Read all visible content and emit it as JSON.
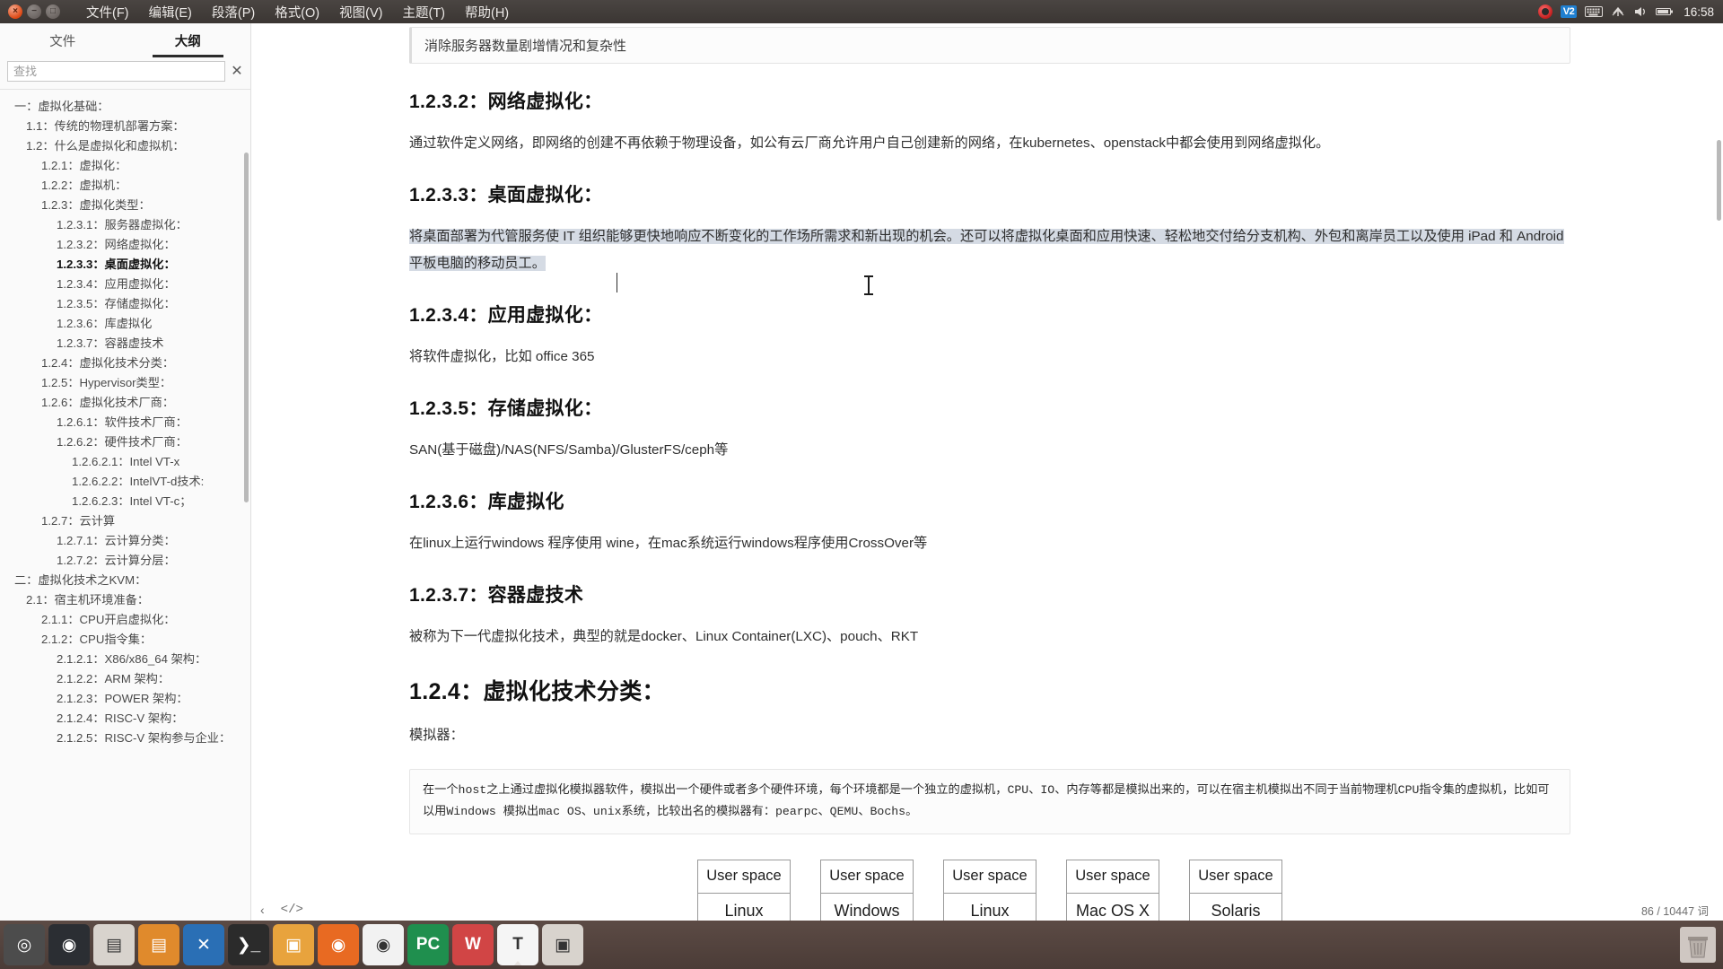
{
  "window": {
    "controls": [
      "close",
      "minimize",
      "maximize"
    ],
    "menu": [
      "文件(F)",
      "编辑(E)",
      "段落(P)",
      "格式(O)",
      "视图(V)",
      "主题(T)",
      "帮助(H)"
    ]
  },
  "tray": {
    "recording_icon": "obs-record-icon",
    "vpn_badge": "V2",
    "keyboard_icon": "keyboard-icon",
    "network_icon": "network-icon",
    "volume_icon": "volume-icon",
    "battery_icon": "battery-icon",
    "time": "16:58"
  },
  "sidebar": {
    "tabs": [
      {
        "label": "文件",
        "active": false
      },
      {
        "label": "大纲",
        "active": true
      }
    ],
    "search": {
      "placeholder": "查找",
      "value": ""
    },
    "clear_label": "✕",
    "outline": [
      {
        "level": 1,
        "label": "一：虚拟化基础：",
        "selected": false
      },
      {
        "level": 2,
        "label": "1.1：传统的物理机部署方案：",
        "selected": false
      },
      {
        "level": 2,
        "label": "1.2：什么是虚拟化和虚拟机：",
        "selected": false
      },
      {
        "level": 3,
        "label": "1.2.1：虚拟化：",
        "selected": false
      },
      {
        "level": 3,
        "label": "1.2.2：虚拟机：",
        "selected": false
      },
      {
        "level": 3,
        "label": "1.2.3：虚拟化类型：",
        "selected": false
      },
      {
        "level": 4,
        "label": "1.2.3.1：服务器虚拟化：",
        "selected": false
      },
      {
        "level": 4,
        "label": "1.2.3.2：网络虚拟化：",
        "selected": false
      },
      {
        "level": 4,
        "label": "1.2.3.3：桌面虚拟化：",
        "selected": true
      },
      {
        "level": 4,
        "label": "1.2.3.4：应用虚拟化：",
        "selected": false
      },
      {
        "level": 4,
        "label": "1.2.3.5：存储虚拟化：",
        "selected": false
      },
      {
        "level": 4,
        "label": "1.2.3.6：库虚拟化",
        "selected": false
      },
      {
        "level": 4,
        "label": "1.2.3.7：容器虚技术",
        "selected": false
      },
      {
        "level": 3,
        "label": "1.2.4：虚拟化技术分类：",
        "selected": false
      },
      {
        "level": 3,
        "label": "1.2.5：Hypervisor类型：",
        "selected": false
      },
      {
        "level": 3,
        "label": "1.2.6：虚拟化技术厂商：",
        "selected": false
      },
      {
        "level": 4,
        "label": "1.2.6.1：软件技术厂商：",
        "selected": false
      },
      {
        "level": 4,
        "label": "1.2.6.2：硬件技术厂商：",
        "selected": false
      },
      {
        "level": 5,
        "label": "1.2.6.2.1：Intel VT-x",
        "selected": false
      },
      {
        "level": 5,
        "label": "1.2.6.2.2：IntelVT-d技术:",
        "selected": false
      },
      {
        "level": 5,
        "label": "1.2.6.2.3：Intel VT-c；",
        "selected": false
      },
      {
        "level": 3,
        "label": "1.2.7：云计算",
        "selected": false
      },
      {
        "level": 4,
        "label": "1.2.7.1：云计算分类：",
        "selected": false
      },
      {
        "level": 4,
        "label": "1.2.7.2：云计算分层：",
        "selected": false
      },
      {
        "level": 1,
        "label": "二：虚拟化技术之KVM：",
        "selected": false
      },
      {
        "level": 2,
        "label": "2.1：宿主机环境准备：",
        "selected": false
      },
      {
        "level": 3,
        "label": "2.1.1：CPU开启虚拟化：",
        "selected": false
      },
      {
        "level": 3,
        "label": "2.1.2：CPU指令集：",
        "selected": false
      },
      {
        "level": 4,
        "label": "2.1.2.1：X86/x86_64 架构：",
        "selected": false
      },
      {
        "level": 4,
        "label": "2.1.2.2：ARM 架构：",
        "selected": false
      },
      {
        "level": 4,
        "label": "2.1.2.3：POWER 架构：",
        "selected": false
      },
      {
        "level": 4,
        "label": "2.1.2.4：RISC-V 架构：",
        "selected": false
      },
      {
        "level": 4,
        "label": "2.1.2.5：RISC-V 架构参与企业：",
        "selected": false
      }
    ]
  },
  "document": {
    "top_quote": "消除服务器数量剧增情况和复杂性",
    "sections": [
      {
        "heading": "1.2.3.2：网络虚拟化：",
        "paragraph": "通过软件定义网络，即网络的创建不再依赖于物理设备，如公有云厂商允许用户自己创建新的网络，在kubernetes、openstack中都会使用到网络虚拟化。"
      },
      {
        "heading": "1.2.3.3：桌面虚拟化：",
        "paragraph": "将桌面部署为代管服务使 IT 组织能够更快地响应不断变化的工作场所需求和新出现的机会。还可以将虚拟化桌面和应用快速、轻松地交付给分支机构、外包和离岸员工以及使用 iPad 和 Android 平板电脑的移动员工。",
        "highlighted": true
      },
      {
        "heading": "1.2.3.4：应用虚拟化：",
        "paragraph": "将软件虚拟化，比如 office 365"
      },
      {
        "heading": "1.2.3.5：存储虚拟化：",
        "paragraph": "SAN(基于磁盘)/NAS(NFS/Samba)/GlusterFS/ceph等"
      },
      {
        "heading": "1.2.3.6：库虚拟化",
        "paragraph": "在linux上运行windows 程序使用 wine，在mac系统运行windows程序使用CrossOver等"
      },
      {
        "heading": "1.2.3.7：容器虚技术",
        "paragraph": "被称为下一代虚拟化技术，典型的就是docker、Linux Container(LXC)、pouch、RKT"
      }
    ],
    "big_heading": "1.2.4：虚拟化技术分类：",
    "subtitle": "模拟器：",
    "code_block": "在一个host之上通过虚拟化模拟器软件，模拟出一个硬件或者多个硬件环境，每个环境都是一个独立的虚拟机，CPU、IO、内存等都是模拟出来的，可以在宿主机模拟出不同于当前物理机CPU指令集的虚拟机，比如可以用Windows 模拟出mac OS、unix系统，比较出名的模拟器有：pearpc、QEMU、Bochs。",
    "diagram": {
      "top_label": "User space",
      "columns": [
        "Linux",
        "Windows",
        "Linux",
        "Mac OS X",
        "Solaris"
      ]
    }
  },
  "statusbar": {
    "prev_icon": "chevron-left-icon",
    "code_icon": "code-view-icon",
    "word_count": "86 / 10447 词"
  },
  "dock": {
    "items": [
      {
        "name": "ubuntu-dash",
        "label": "",
        "color": "#4c4c4c",
        "glyph": "◎",
        "running": false
      },
      {
        "name": "obs-studio",
        "label": "",
        "color": "#2b2e33",
        "glyph": "◉",
        "running": false
      },
      {
        "name": "files-nautilus",
        "label": "",
        "color": "#d8d3cd",
        "glyph": "▤",
        "running": false
      },
      {
        "name": "file-manager",
        "label": "",
        "color": "#e08a2c",
        "glyph": "▤",
        "running": false
      },
      {
        "name": "vs-code",
        "label": "",
        "color": "#2a6fb5",
        "glyph": "✕",
        "running": false
      },
      {
        "name": "terminal",
        "label": "",
        "color": "#2b2b2b",
        "glyph": "❯_",
        "running": false
      },
      {
        "name": "remmina",
        "label": "",
        "color": "#e8a33d",
        "glyph": "▣",
        "running": false
      },
      {
        "name": "firefox",
        "label": "",
        "color": "#e86a22",
        "glyph": "◉",
        "running": false
      },
      {
        "name": "google-chrome",
        "label": "",
        "color": "#f2f2f2",
        "glyph": "◉",
        "running": false
      },
      {
        "name": "pycharm",
        "label": "PC",
        "color": "#1f8f4e",
        "glyph": "PC",
        "running": false
      },
      {
        "name": "wps-writer",
        "label": "W",
        "color": "#d14545",
        "glyph": "W",
        "running": false
      },
      {
        "name": "typora",
        "label": "T",
        "color": "#f5f5f5",
        "glyph": "T",
        "running": true
      },
      {
        "name": "archive-manager",
        "label": "",
        "color": "#d8d3cd",
        "glyph": "▣",
        "running": false
      }
    ],
    "trash": "trash-icon"
  }
}
